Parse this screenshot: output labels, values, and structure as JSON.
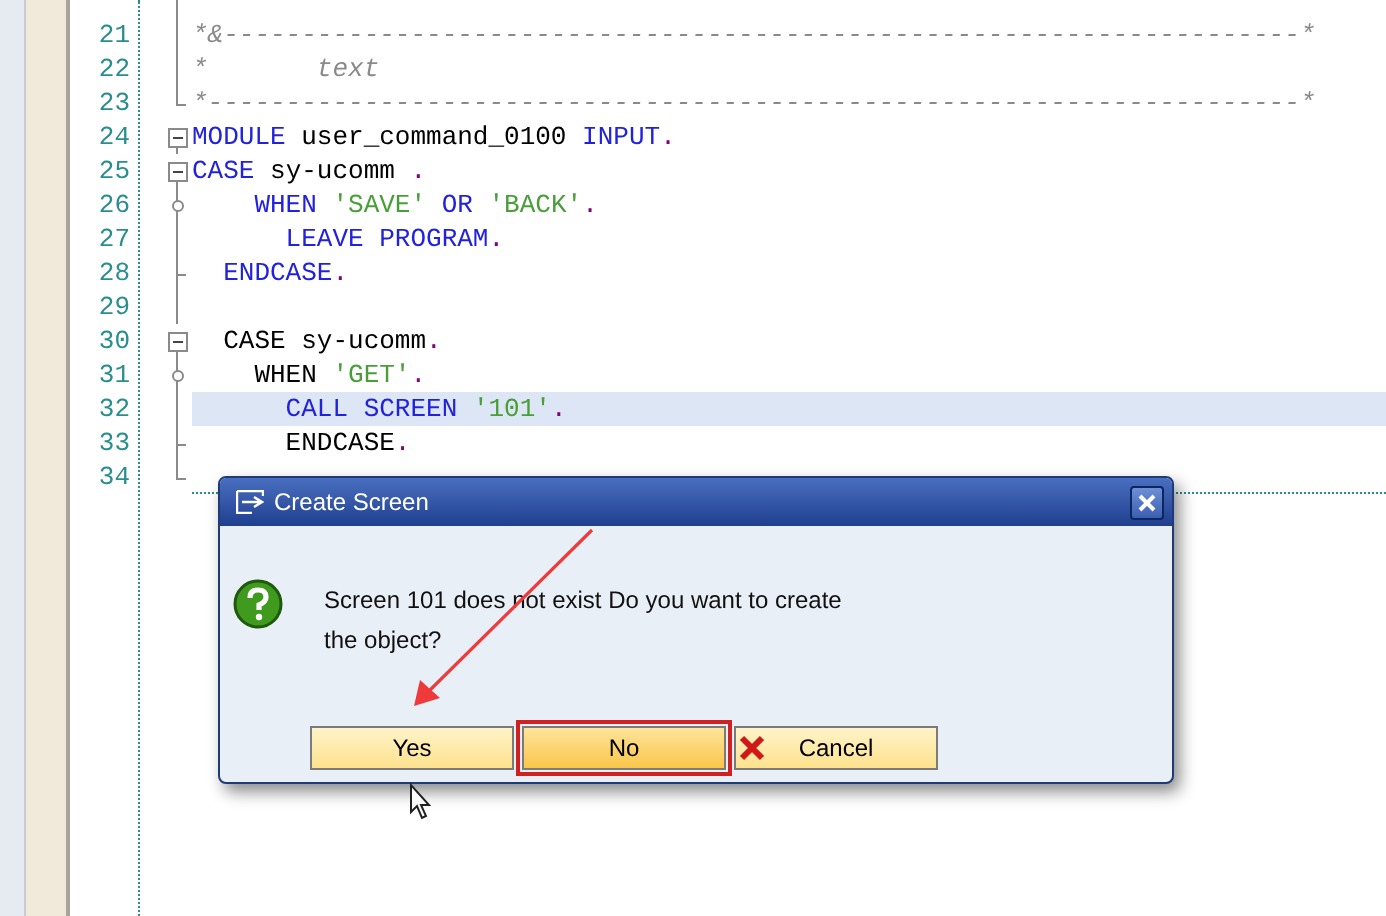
{
  "editor": {
    "lines": [
      {
        "number": "21",
        "kind": "line",
        "selected": false,
        "tokens": [
          {
            "kind": "comment",
            "text": "*&---------------------------------------------------------------------*"
          }
        ]
      },
      {
        "number": "22",
        "kind": "line",
        "selected": false,
        "tokens": [
          {
            "kind": "comment",
            "text": "*       text"
          }
        ]
      },
      {
        "number": "23",
        "kind": "corner",
        "selected": false,
        "tokens": [
          {
            "kind": "comment",
            "text": "*----------------------------------------------------------------------*"
          }
        ]
      },
      {
        "number": "24",
        "kind": "start",
        "selected": false,
        "tokens": [
          {
            "kind": "keyword",
            "text": "MODULE"
          },
          {
            "kind": "plain",
            "text": " user_command_0100 "
          },
          {
            "kind": "keyword",
            "text": "INPUT"
          },
          {
            "kind": "dot",
            "text": "."
          }
        ]
      },
      {
        "number": "25",
        "kind": "start",
        "selected": false,
        "tokens": [
          {
            "kind": "keyword",
            "text": "CASE"
          },
          {
            "kind": "plain",
            "text": " sy-ucomm "
          },
          {
            "kind": "dot",
            "text": "."
          }
        ]
      },
      {
        "number": "26",
        "kind": "node",
        "selected": false,
        "tokens": [
          {
            "kind": "keyword",
            "text": "    WHEN "
          },
          {
            "kind": "string",
            "text": "'SAVE'"
          },
          {
            "kind": "keyword",
            "text": " OR "
          },
          {
            "kind": "string",
            "text": "'BACK'"
          },
          {
            "kind": "dot",
            "text": "."
          }
        ]
      },
      {
        "number": "27",
        "kind": "line",
        "selected": false,
        "tokens": [
          {
            "kind": "keyword",
            "text": "      LEAVE PROGRAM"
          },
          {
            "kind": "dot",
            "text": "."
          }
        ]
      },
      {
        "number": "28",
        "kind": "end",
        "selected": false,
        "tokens": [
          {
            "kind": "keyword",
            "text": "  ENDCASE"
          },
          {
            "kind": "dot",
            "text": "."
          }
        ]
      },
      {
        "number": "29",
        "kind": "line",
        "selected": false
      },
      {
        "number": "30",
        "kind": "start",
        "selected": false,
        "tokens": [
          {
            "kind": "plain",
            "text": "  CASE sy-ucomm"
          },
          {
            "kind": "dot",
            "text": "."
          }
        ]
      },
      {
        "number": "31",
        "kind": "node",
        "selected": false,
        "tokens": [
          {
            "kind": "plain",
            "text": "    WHEN "
          },
          {
            "kind": "string",
            "text": "'GET'"
          },
          {
            "kind": "dot",
            "text": "."
          }
        ]
      },
      {
        "number": "32",
        "kind": "line",
        "selected": true,
        "tokens": [
          {
            "kind": "keyword",
            "text": "      CALL SCREEN "
          },
          {
            "kind": "string",
            "text": "'101'"
          },
          {
            "kind": "dot",
            "text": "."
          }
        ]
      },
      {
        "number": "33",
        "kind": "end",
        "selected": false,
        "tokens": [
          {
            "kind": "plain",
            "text": "      ENDCASE"
          },
          {
            "kind": "dot",
            "text": "."
          }
        ]
      },
      {
        "number": "34",
        "kind": "corner",
        "selected": false
      }
    ]
  },
  "dialog": {
    "title": "Create Screen",
    "message": "Screen 101 does not exist Do you want to create the object?",
    "buttons": [
      {
        "label": "Yes",
        "kind": "plain",
        "selected": false
      },
      {
        "label": "No",
        "kind": "plain",
        "selected": true
      },
      {
        "label": "Cancel",
        "kind": "cancel",
        "selected": false
      }
    ]
  }
}
